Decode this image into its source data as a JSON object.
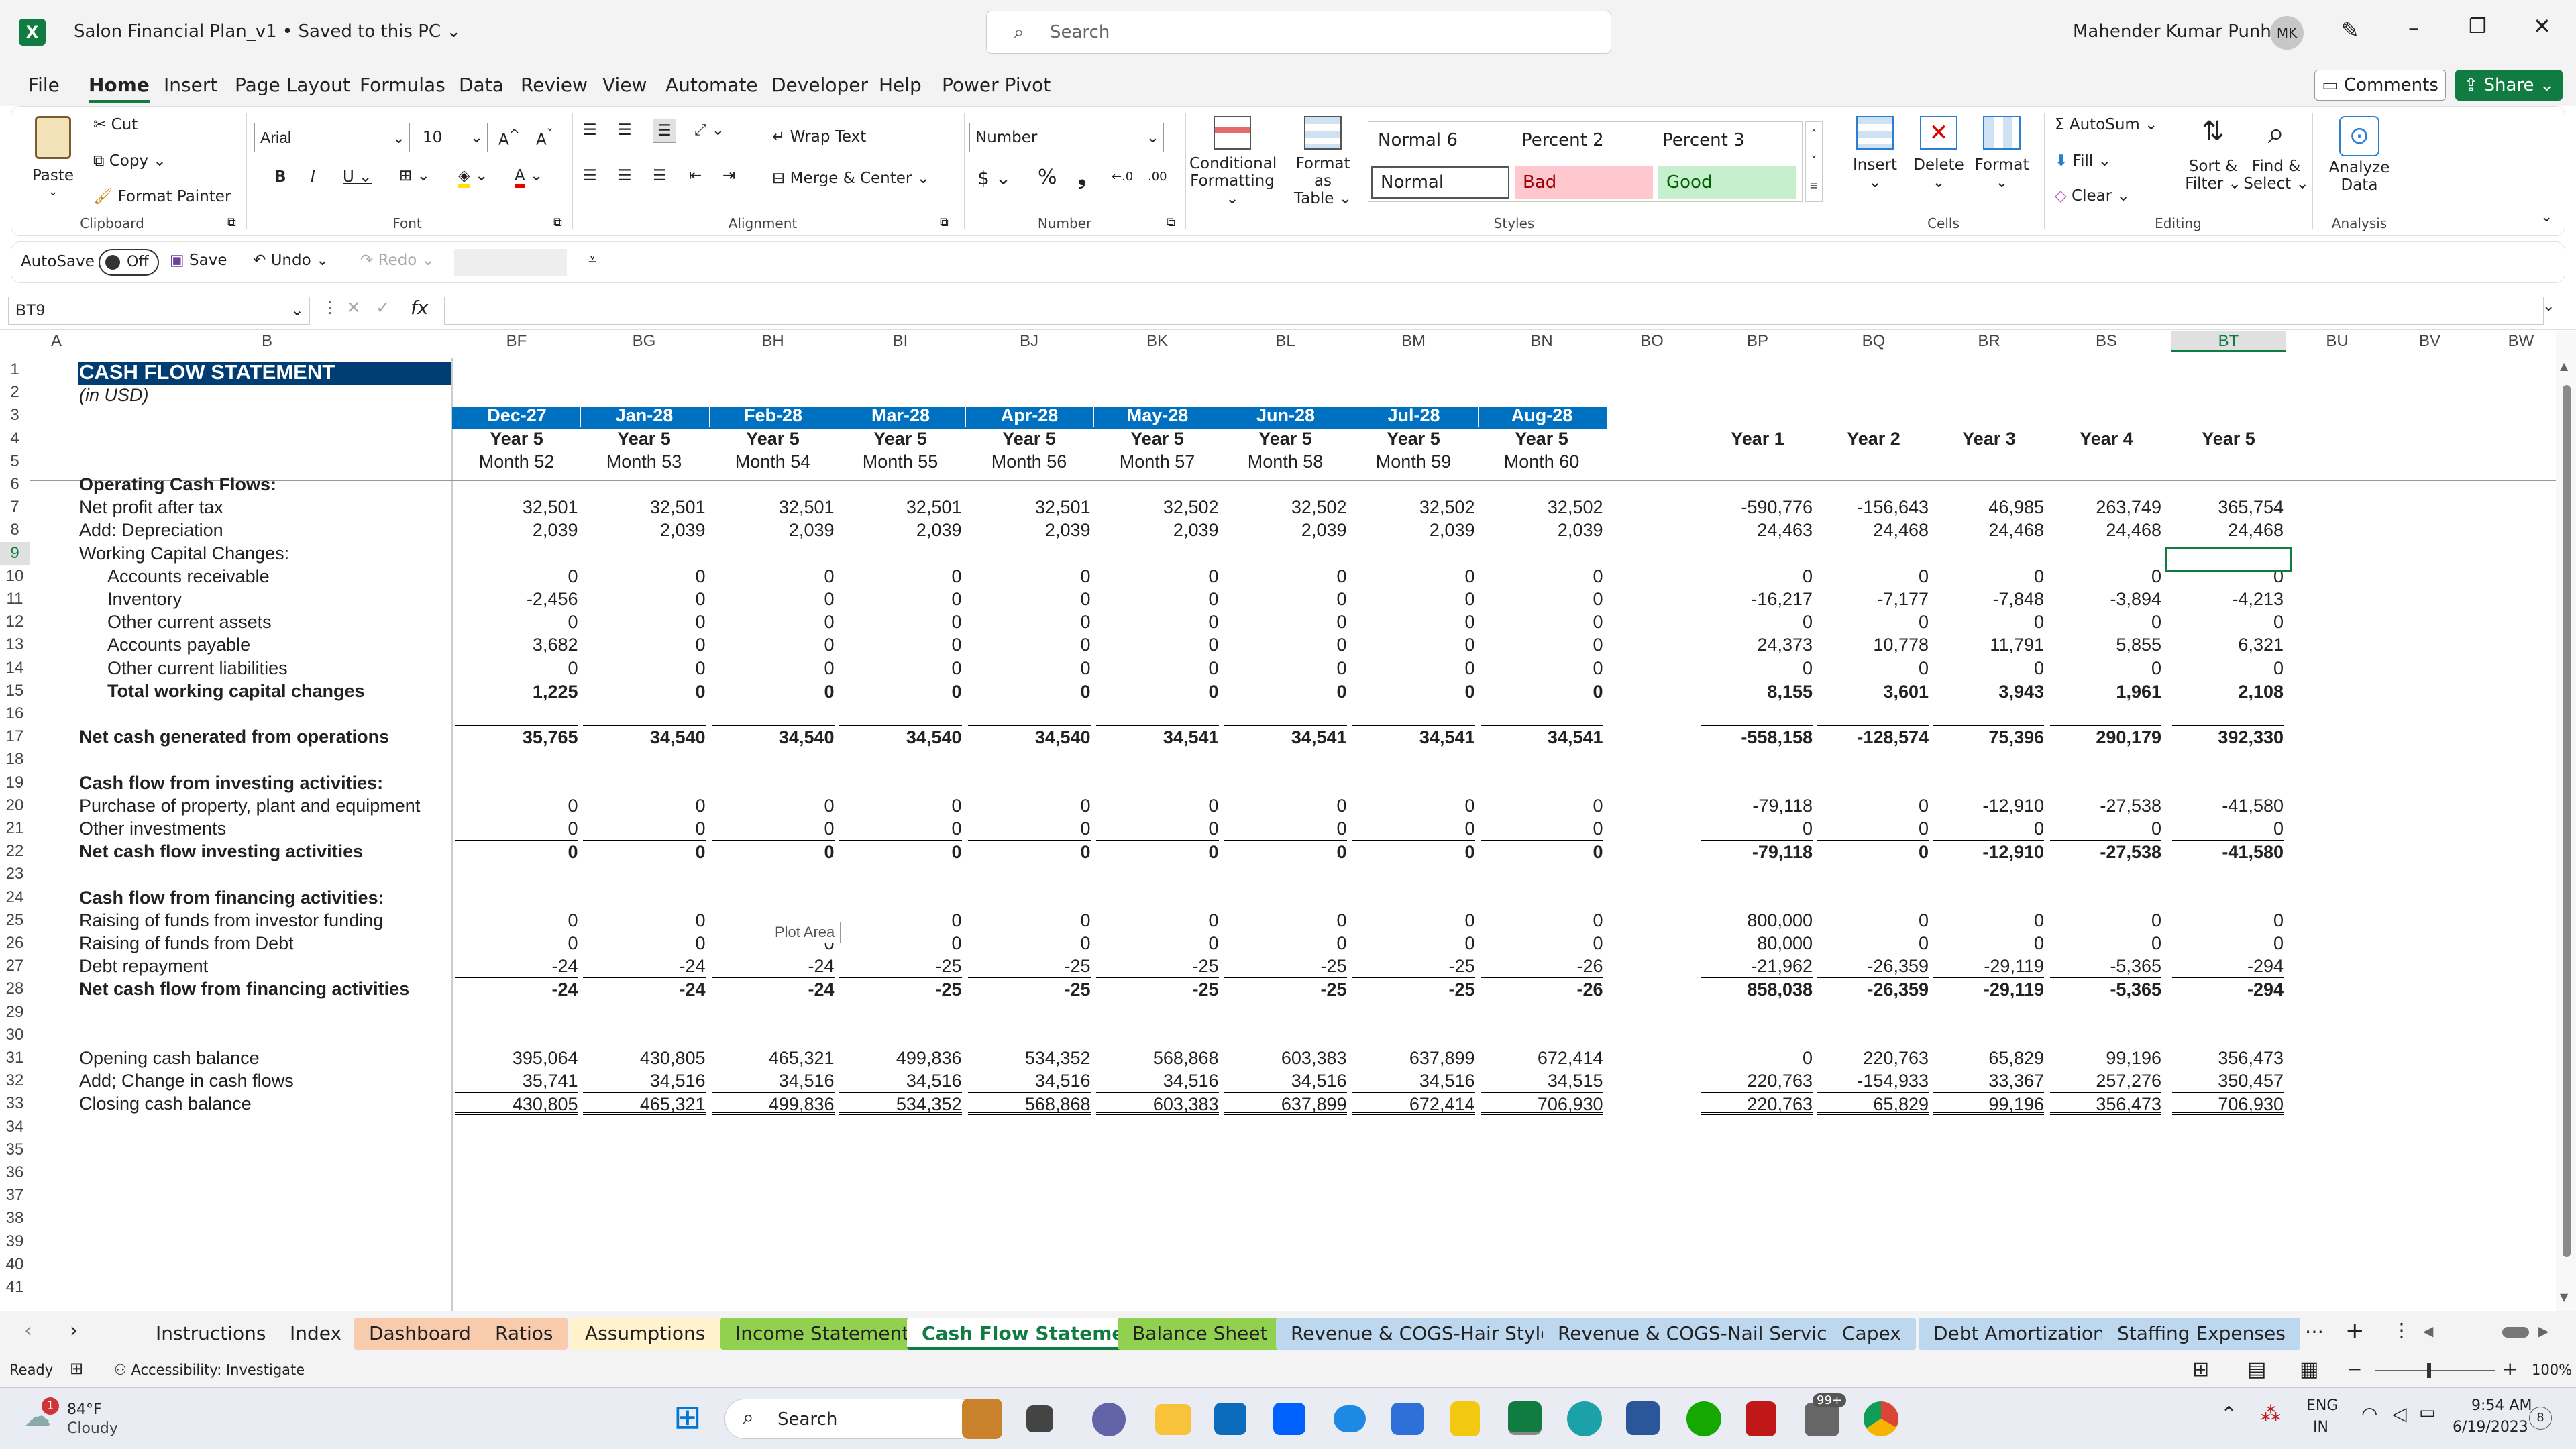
{
  "title": {
    "filename": "Salon Financial Plan_v1",
    "saved": "Saved to this PC",
    "search_placeholder": "Search",
    "user": "Mahender Kumar Punhani",
    "initials": "MK"
  },
  "menu": [
    "File",
    "Home",
    "Insert",
    "Page Layout",
    "Formulas",
    "Data",
    "Review",
    "View",
    "Automate",
    "Developer",
    "Help",
    "Power Pivot"
  ],
  "buttons": {
    "comments": "Comments",
    "share": "Share"
  },
  "ribbon": {
    "paste": "Paste",
    "cut": "Cut",
    "copy": "Copy",
    "format_painter": "Format Painter",
    "clipboard": "Clipboard",
    "font_name": "Arial",
    "font_size": "10",
    "font": "Font",
    "wrap_text": "Wrap Text",
    "merge_center": "Merge & Center",
    "alignment": "Alignment",
    "number_format": "Number",
    "number": "Number",
    "cond_format_1": "Conditional",
    "cond_format_2": "Formatting",
    "format_table_1": "Format as",
    "format_table_2": "Table",
    "style_normal6": "Normal 6",
    "style_percent2": "Percent 2",
    "style_percent3": "Percent 3",
    "style_normal": "Normal",
    "style_bad": "Bad",
    "style_good": "Good",
    "styles": "Styles",
    "insert": "Insert",
    "delete": "Delete",
    "format": "Format",
    "cells": "Cells",
    "autosum": "AutoSum",
    "fill": "Fill",
    "clear": "Clear",
    "sort_1": "Sort &",
    "sort_2": "Filter",
    "find_1": "Find &",
    "find_2": "Select",
    "editing": "Editing",
    "analyze_1": "Analyze",
    "analyze_2": "Data",
    "analysis": "Analysis"
  },
  "qat": {
    "autosave": "AutoSave",
    "off": "Off",
    "save": "Save",
    "undo": "Undo",
    "redo": "Redo"
  },
  "namebox": "BT9",
  "columns": {
    "A": "A",
    "B": "B",
    "months": [
      "BF",
      "BG",
      "BH",
      "BI",
      "BJ",
      "BK",
      "BL",
      "BM",
      "BN"
    ],
    "BO": "BO",
    "years": [
      "BP",
      "BQ",
      "BR",
      "BS",
      "BT"
    ],
    "extra": [
      "BU",
      "BV",
      "BW"
    ]
  },
  "sheet": {
    "title": "CASH FLOW STATEMENT",
    "subtitle": "(in USD)",
    "dates": [
      "Dec-27",
      "Jan-28",
      "Feb-28",
      "Mar-28",
      "Apr-28",
      "May-28",
      "Jun-28",
      "Jul-28",
      "Aug-28"
    ],
    "year_row": [
      "Year 5",
      "Year 5",
      "Year 5",
      "Year 5",
      "Year 5",
      "Year 5",
      "Year 5",
      "Year 5",
      "Year 5"
    ],
    "month_row": [
      "Month 52",
      "Month 53",
      "Month 54",
      "Month 55",
      "Month 56",
      "Month 57",
      "Month 58",
      "Month 59",
      "Month 60"
    ],
    "year_headers": [
      "Year 1",
      "Year 2",
      "Year 3",
      "Year 4",
      "Year 5"
    ],
    "rows": [
      {
        "r": 6,
        "label": "Operating Cash Flows:",
        "bold": true,
        "m": [],
        "y": []
      },
      {
        "r": 7,
        "label": "Net profit after tax",
        "m": [
          "32,501",
          "32,501",
          "32,501",
          "32,501",
          "32,501",
          "32,502",
          "32,502",
          "32,502",
          "32,502"
        ],
        "y": [
          "-590,776",
          "-156,643",
          "46,985",
          "263,749",
          "365,754"
        ]
      },
      {
        "r": 8,
        "label": "Add: Depreciation",
        "m": [
          "2,039",
          "2,039",
          "2,039",
          "2,039",
          "2,039",
          "2,039",
          "2,039",
          "2,039",
          "2,039"
        ],
        "y": [
          "24,463",
          "24,468",
          "24,468",
          "24,468",
          "24,468"
        ]
      },
      {
        "r": 9,
        "label": "Working Capital Changes:",
        "m": [],
        "y": []
      },
      {
        "r": 10,
        "label": "Accounts receivable",
        "indent": true,
        "m": [
          "0",
          "0",
          "0",
          "0",
          "0",
          "0",
          "0",
          "0",
          "0"
        ],
        "y": [
          "0",
          "0",
          "0",
          "0",
          "0"
        ]
      },
      {
        "r": 11,
        "label": "Inventory",
        "indent": true,
        "m": [
          "-2,456",
          "0",
          "0",
          "0",
          "0",
          "0",
          "0",
          "0",
          "0"
        ],
        "y": [
          "-16,217",
          "-7,177",
          "-7,848",
          "-3,894",
          "-4,213"
        ]
      },
      {
        "r": 12,
        "label": "Other current assets",
        "indent": true,
        "m": [
          "0",
          "0",
          "0",
          "0",
          "0",
          "0",
          "0",
          "0",
          "0"
        ],
        "y": [
          "0",
          "0",
          "0",
          "0",
          "0"
        ]
      },
      {
        "r": 13,
        "label": "Accounts payable",
        "indent": true,
        "m": [
          "3,682",
          "0",
          "0",
          "0",
          "0",
          "0",
          "0",
          "0",
          "0"
        ],
        "y": [
          "24,373",
          "10,778",
          "11,791",
          "5,855",
          "6,321"
        ]
      },
      {
        "r": 14,
        "label": "Other current liabilities",
        "indent": true,
        "m": [
          "0",
          "0",
          "0",
          "0",
          "0",
          "0",
          "0",
          "0",
          "0"
        ],
        "y": [
          "0",
          "0",
          "0",
          "0",
          "0"
        ]
      },
      {
        "r": 15,
        "label": "Total working capital changes",
        "indent": true,
        "bold": true,
        "top": true,
        "m": [
          "1,225",
          "0",
          "0",
          "0",
          "0",
          "0",
          "0",
          "0",
          "0"
        ],
        "y": [
          "8,155",
          "3,601",
          "3,943",
          "1,961",
          "2,108"
        ]
      },
      {
        "r": 17,
        "label": "Net cash generated from operations",
        "bold": true,
        "top": true,
        "m": [
          "35,765",
          "34,540",
          "34,540",
          "34,540",
          "34,540",
          "34,541",
          "34,541",
          "34,541",
          "34,541"
        ],
        "y": [
          "-558,158",
          "-128,574",
          "75,396",
          "290,179",
          "392,330"
        ]
      },
      {
        "r": 19,
        "label": "Cash flow from investing activities:",
        "bold": true,
        "m": [],
        "y": []
      },
      {
        "r": 20,
        "label": "Purchase of property, plant and equipment",
        "m": [
          "0",
          "0",
          "0",
          "0",
          "0",
          "0",
          "0",
          "0",
          "0"
        ],
        "y": [
          "-79,118",
          "0",
          "-12,910",
          "-27,538",
          "-41,580"
        ]
      },
      {
        "r": 21,
        "label": "Other investments",
        "m": [
          "0",
          "0",
          "0",
          "0",
          "0",
          "0",
          "0",
          "0",
          "0"
        ],
        "y": [
          "0",
          "0",
          "0",
          "0",
          "0"
        ]
      },
      {
        "r": 22,
        "label": "Net cash flow investing activities",
        "bold": true,
        "top": true,
        "m": [
          "0",
          "0",
          "0",
          "0",
          "0",
          "0",
          "0",
          "0",
          "0"
        ],
        "y": [
          "-79,118",
          "0",
          "-12,910",
          "-27,538",
          "-41,580"
        ]
      },
      {
        "r": 24,
        "label": "Cash flow from financing activities:",
        "bold": true,
        "m": [],
        "y": []
      },
      {
        "r": 25,
        "label": "Raising of funds from investor funding",
        "m": [
          "0",
          "0",
          "",
          "0",
          "0",
          "0",
          "0",
          "0",
          "0"
        ],
        "y": [
          "800,000",
          "0",
          "0",
          "0",
          "0"
        ]
      },
      {
        "r": 26,
        "label": "Raising of funds from Debt",
        "m": [
          "0",
          "0",
          "0",
          "0",
          "0",
          "0",
          "0",
          "0",
          "0"
        ],
        "y": [
          "80,000",
          "0",
          "0",
          "0",
          "0"
        ]
      },
      {
        "r": 27,
        "label": "Debt repayment",
        "m": [
          "-24",
          "-24",
          "-24",
          "-25",
          "-25",
          "-25",
          "-25",
          "-25",
          "-26"
        ],
        "y": [
          "-21,962",
          "-26,359",
          "-29,119",
          "-5,365",
          "-294"
        ]
      },
      {
        "r": 28,
        "label": "Net cash flow from financing activities",
        "bold": true,
        "top": true,
        "m": [
          "-24",
          "-24",
          "-24",
          "-25",
          "-25",
          "-25",
          "-25",
          "-25",
          "-26"
        ],
        "y": [
          "858,038",
          "-26,359",
          "-29,119",
          "-5,365",
          "-294"
        ]
      },
      {
        "r": 31,
        "label": "Opening cash balance",
        "m": [
          "395,064",
          "430,805",
          "465,321",
          "499,836",
          "534,352",
          "568,868",
          "603,383",
          "637,899",
          "672,414"
        ],
        "y": [
          "0",
          "220,763",
          "65,829",
          "99,196",
          "356,473"
        ]
      },
      {
        "r": 32,
        "label": "Add; Change in cash flows",
        "m": [
          "35,741",
          "34,516",
          "34,516",
          "34,516",
          "34,516",
          "34,516",
          "34,516",
          "34,516",
          "34,515"
        ],
        "y": [
          "220,763",
          "-154,933",
          "33,367",
          "257,276",
          "350,457"
        ]
      },
      {
        "r": 33,
        "label": "Closing cash balance",
        "top": true,
        "double": true,
        "m": [
          "430,805",
          "465,321",
          "499,836",
          "534,352",
          "568,868",
          "603,383",
          "637,899",
          "672,414",
          "706,930"
        ],
        "y": [
          "220,763",
          "65,829",
          "99,196",
          "356,473",
          "706,930"
        ]
      }
    ],
    "tooltip": "Plot Area"
  },
  "tabs": [
    {
      "label": "Instructions",
      "color": ""
    },
    {
      "label": "Index",
      "color": ""
    },
    {
      "label": "Dashboard",
      "color": "#f8cbad"
    },
    {
      "label": "Ratios",
      "color": "#f8cbad"
    },
    {
      "label": "Assumptions",
      "color": "#fff2cc"
    },
    {
      "label": "Income Statement",
      "color": "#92d050"
    },
    {
      "label": "Cash Flow Statement",
      "color": "",
      "active": true
    },
    {
      "label": "Balance Sheet",
      "color": "#92d050"
    },
    {
      "label": "Revenue & COGS-Hair Style",
      "color": "#bdd7ee"
    },
    {
      "label": "Revenue & COGS-Nail Services",
      "color": "#bdd7ee"
    },
    {
      "label": "Capex",
      "color": "#bdd7ee"
    },
    {
      "label": "Debt Amortization",
      "color": "#bdd7ee"
    },
    {
      "label": "Staffing Expenses",
      "color": "#bdd7ee"
    }
  ],
  "status": {
    "ready": "Ready",
    "accessibility": "Accessibility: Investigate",
    "zoom": "100%"
  },
  "taskbar": {
    "temp": "84°F",
    "weather": "Cloudy",
    "search": "Search",
    "badge": "99+",
    "lang1": "ENG",
    "lang2": "IN",
    "time": "9:54 AM",
    "date": "6/19/2023",
    "notif": "8",
    "weather_badge": "1"
  }
}
